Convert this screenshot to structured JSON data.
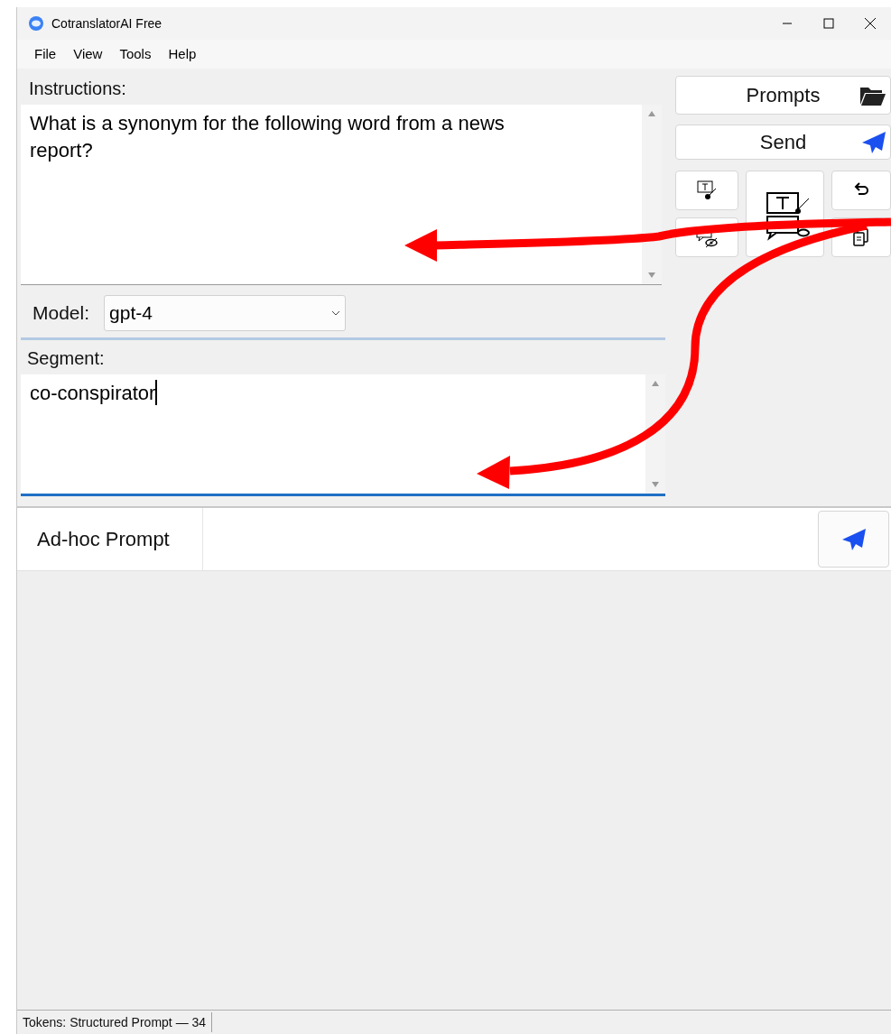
{
  "window": {
    "title": "CotranslatorAI Free"
  },
  "menu": [
    "File",
    "View",
    "Tools",
    "Help"
  ],
  "instructions": {
    "label": "Instructions:",
    "value": "What is a synonym for the following word from a news report?"
  },
  "model": {
    "label": "Model:",
    "value": "gpt-4"
  },
  "segment": {
    "label": "Segment:",
    "value": "co-conspirator",
    "focused": true
  },
  "buttons": [
    {
      "label": "Prompts"
    },
    {
      "label": "Send"
    }
  ],
  "adhoc": {
    "label": "Ad-hoc Prompt"
  },
  "status_bar": {
    "text": "Tokens: Structured Prompt — 34"
  }
}
